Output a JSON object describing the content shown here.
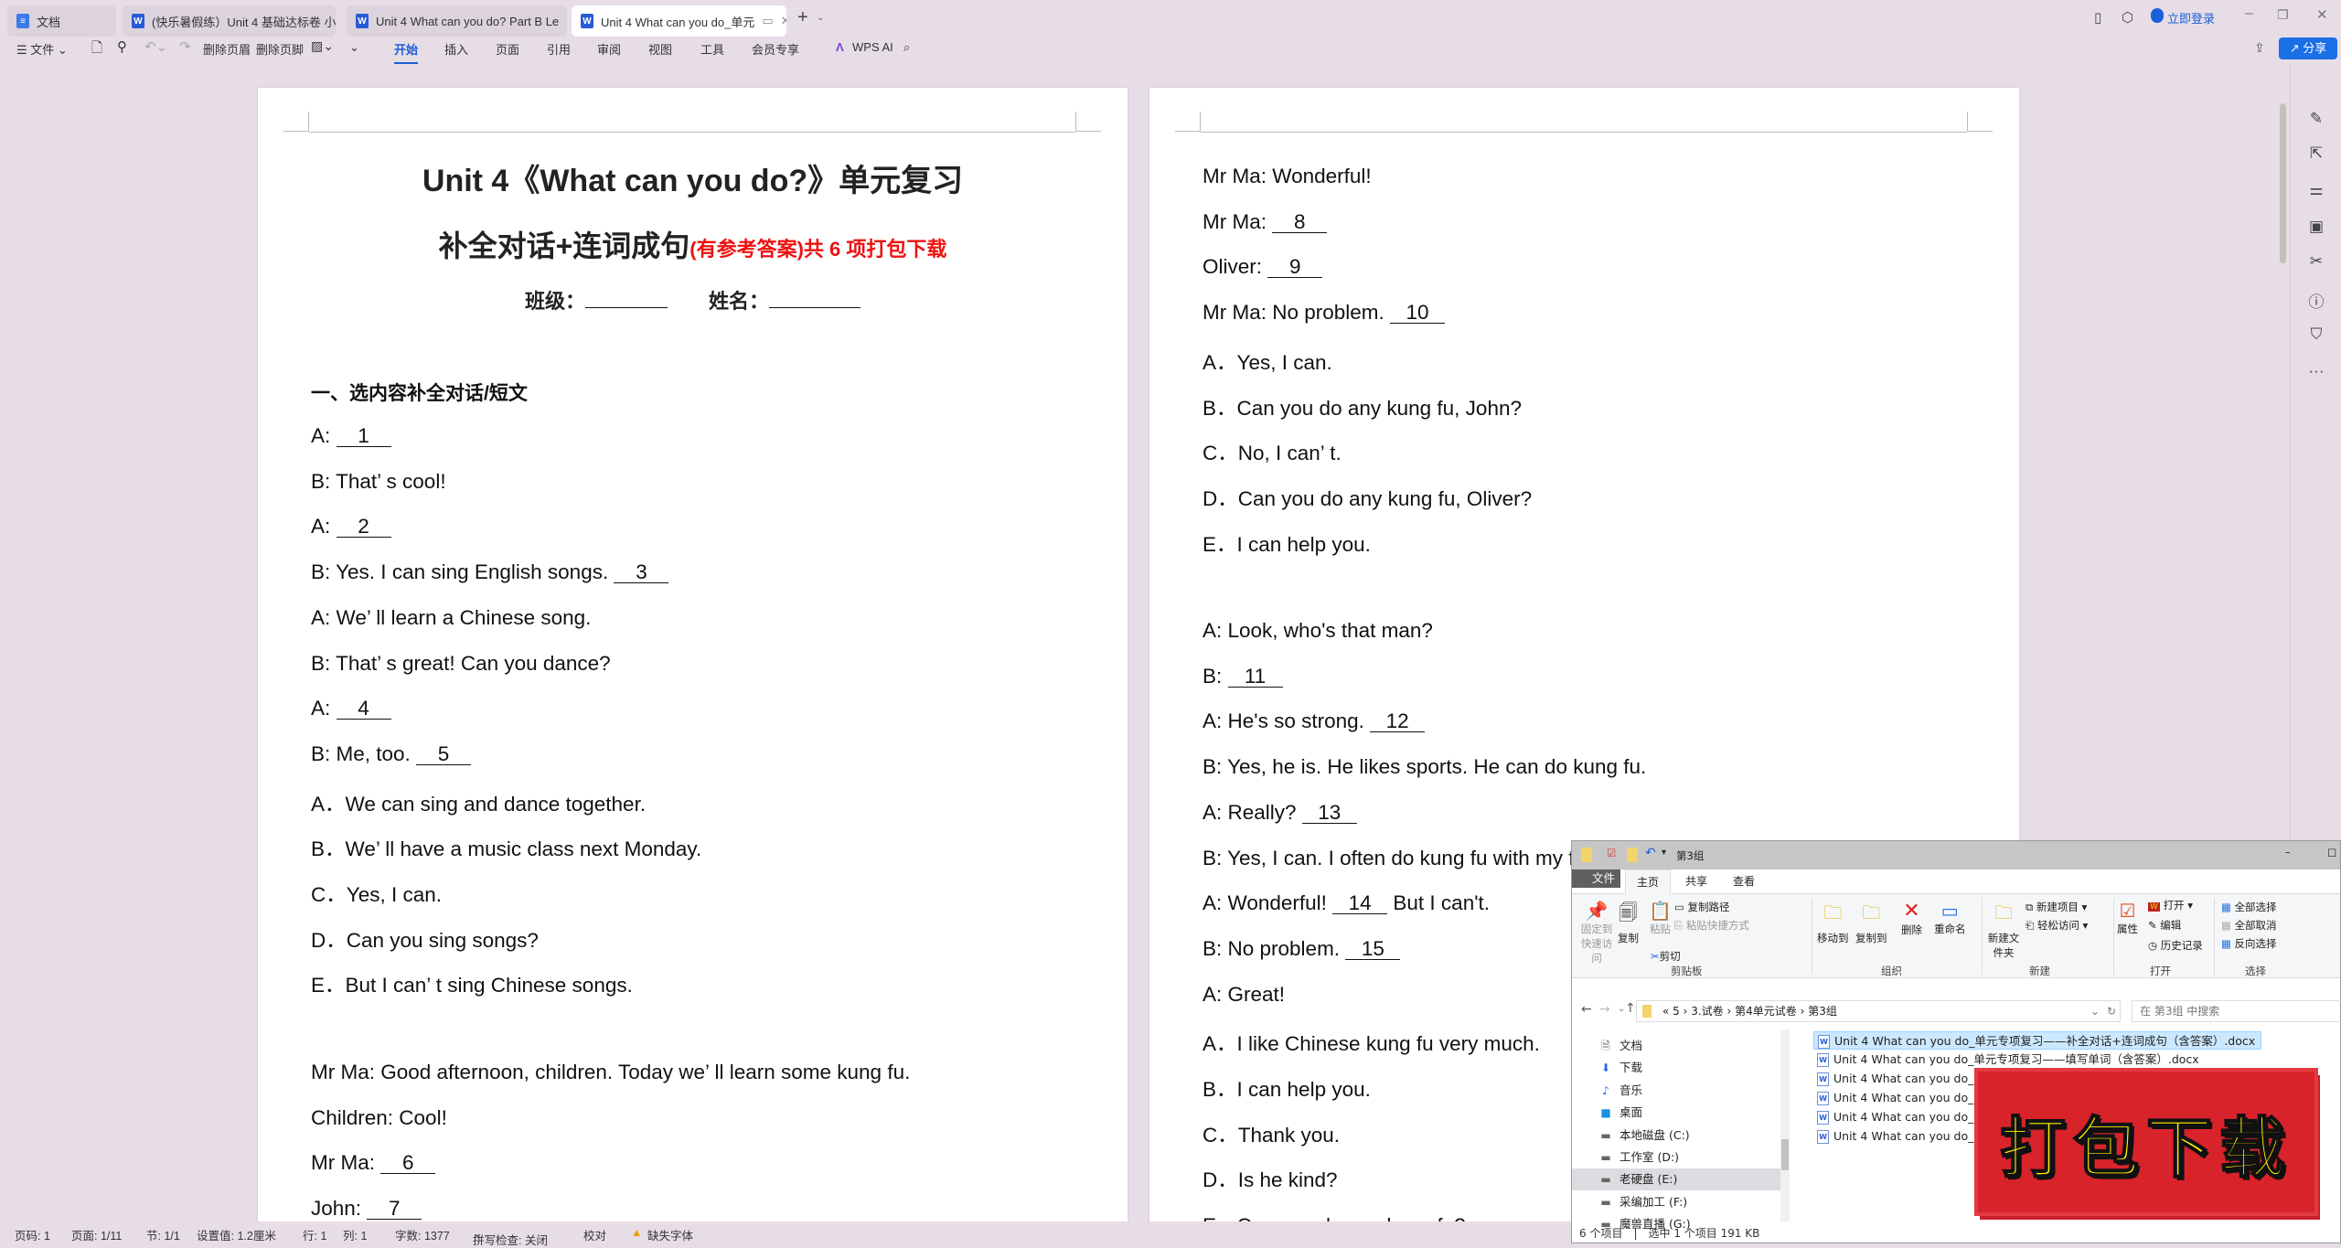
{
  "tabs": [
    {
      "label": "文档"
    },
    {
      "label": "(快乐暑假练）Unit 4  基础达标卷 小"
    },
    {
      "label": "Unit 4 What can you do?  Part B Le"
    },
    {
      "label": "Unit 4 What can you do_单元"
    }
  ],
  "titlebar": {
    "login": "立即登录",
    "share": "分享"
  },
  "toolbar": {
    "file": "文件",
    "del_header": "删除页眉",
    "del_footer": "删除页脚",
    "menu": [
      "开始",
      "插入",
      "页面",
      "引用",
      "审阅",
      "视图",
      "工具",
      "会员专享"
    ],
    "active": "开始",
    "wps_ai": "WPS AI"
  },
  "page1": {
    "title": "Unit 4《What can you do?》单元复习",
    "subtitle": "补全对话+连词成句",
    "subtitle_red": "(有参考答案)共 6 项打包下载",
    "class_label": "班级：",
    "name_label": "姓名：",
    "section": "一、选内容补全对话/短文",
    "lines": [
      {
        "t": "A: ",
        "b": "1"
      },
      {
        "t": "B: That’ s cool!"
      },
      {
        "t": "A: ",
        "b": "2"
      },
      {
        "t": "B: Yes. I can sing English songs. ",
        "b": "3"
      },
      {
        "t": "A: We’ ll learn a Chinese song."
      },
      {
        "t": "B: That’ s great! Can you dance?"
      },
      {
        "t": "A: ",
        "b": "4"
      },
      {
        "t": "B: Me, too. ",
        "b": "5"
      },
      {
        "t": "A．We can sing and dance together."
      },
      {
        "t": "B．We’ ll have a music class next Monday."
      },
      {
        "t": "C．Yes, I can."
      },
      {
        "t": "D．Can you sing songs?"
      },
      {
        "t": "E．But I can’ t sing Chinese songs."
      },
      {
        "t": ""
      },
      {
        "t": "Mr Ma: Good afternoon, children. Today we’ ll learn some kung fu."
      },
      {
        "t": "Children: Cool!"
      },
      {
        "t": "Mr Ma: ",
        "b": "6"
      },
      {
        "t": "John: ",
        "b": "7"
      }
    ]
  },
  "page2": {
    "lines": [
      {
        "t": "Mr Ma: Wonderful!"
      },
      {
        "t": "Mr Ma: ",
        "b": "8"
      },
      {
        "t": "Oliver: ",
        "b": "9"
      },
      {
        "t": "Mr Ma: No problem. ",
        "b": "10"
      },
      {
        "t": "A．Yes, I can."
      },
      {
        "t": "B．Can you do any kung fu, John?"
      },
      {
        "t": "C．No, I can’ t."
      },
      {
        "t": "D．Can you do any kung fu, Oliver?"
      },
      {
        "t": "E．I can help you."
      },
      {
        "t": ""
      },
      {
        "t": "A: Look, who's that man?"
      },
      {
        "t": "B: ",
        "b": "11"
      },
      {
        "t": "A: He's so strong. ",
        "b": "12"
      },
      {
        "t": "B: Yes, he is. He likes sports. He can do kung fu."
      },
      {
        "t": "A: Really? ",
        "b": "13"
      },
      {
        "t": "B: Yes, I can. I often do kung fu with my f"
      },
      {
        "t": "A: Wonderful! ",
        "b": "14",
        "a": " But I can't."
      },
      {
        "t": "B: No problem. ",
        "b": "15"
      },
      {
        "t": "A: Great!"
      },
      {
        "t": "A．I like Chinese kung fu very much."
      },
      {
        "t": "B．I can help you."
      },
      {
        "t": "C．Thank you."
      },
      {
        "t": "D．Is he kind?"
      },
      {
        "t": "E．Can you do any kung fu?"
      }
    ]
  },
  "statusbar": {
    "page_no": "页码: 1",
    "pages": "页面: 1/11",
    "section": "节: 1/1",
    "setting": "设置值: 1.2厘米",
    "row": "行: 1",
    "col": "列: 1",
    "words": "字数: 1377",
    "spell": "拼写检查: 关闭",
    "proof": "校对",
    "missing_font": "缺失字体"
  },
  "explorer": {
    "title": "第3组",
    "tabs": [
      "文件",
      "主页",
      "共享",
      "查看"
    ],
    "ribbon": {
      "pin": "固定到快速访问",
      "copy": "复制",
      "paste": "粘贴",
      "copy_path": "复制路径",
      "paste_shortcut": "粘贴快捷方式",
      "cut": "剪切",
      "move_to": "移动到",
      "copy_to": "复制到",
      "delete": "删除",
      "rename": "重命名",
      "new_folder": "新建文件夹",
      "new_item": "新建项目",
      "easy_access": "轻松访问",
      "properties": "属性",
      "open": "打开",
      "edit": "编辑",
      "history": "历史记录",
      "select_all": "全部选择",
      "select_none": "全部取消",
      "invert": "反向选择",
      "groups": [
        "剪贴板",
        "组织",
        "新建",
        "打开",
        "选择"
      ]
    },
    "breadcrumb": [
      "5",
      "3.试卷",
      "第4单元试卷",
      "第3组"
    ],
    "search_placeholder": "在 第3组 中搜索",
    "nav": [
      {
        "label": "文档",
        "icon": "document-icon"
      },
      {
        "label": "下载",
        "icon": "download-icon"
      },
      {
        "label": "音乐",
        "icon": "music-icon"
      },
      {
        "label": "桌面",
        "icon": "desktop-icon"
      },
      {
        "label": "本地磁盘 (C:)",
        "icon": "drive-icon"
      },
      {
        "label": "工作室 (D:)",
        "icon": "drive-icon"
      },
      {
        "label": "老硬盘 (E:)",
        "icon": "drive-icon",
        "selected": true
      },
      {
        "label": "采编加工 (F:)",
        "icon": "drive-icon"
      },
      {
        "label": "魔兽直播 (G:)",
        "icon": "drive-icon"
      }
    ],
    "files": [
      "Unit 4 What can you do_单元专项复习——补全对话+连词成句（含答案）.docx",
      "Unit 4 What can you do_单元专项复习——填写单词（含答案）.docx",
      "Unit 4 What can you do_能力提升卷",
      "Unit 4 What can you do_单元专",
      "Unit 4 What can you do_单元专",
      "Unit 4 What can you do_单元专"
    ],
    "status": {
      "count": "6 个项目",
      "selected": "选中 1 个项目  191 KB"
    }
  },
  "stamp": {
    "text": "打包下载",
    "bg": "#d8232b",
    "fg": "#fff200"
  },
  "colors": {
    "accent": "#1a5fd6",
    "app_bg": "#e7dde7",
    "red_note": "#ee1111"
  }
}
